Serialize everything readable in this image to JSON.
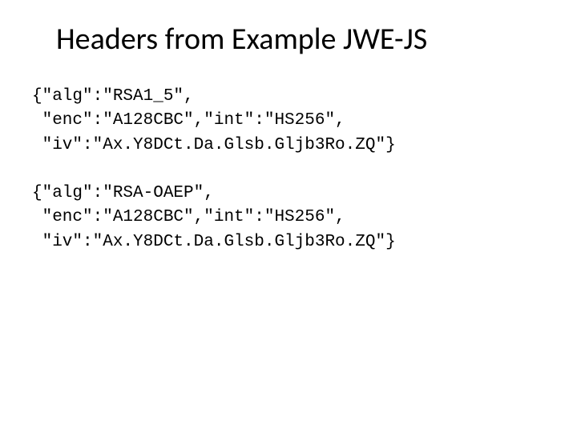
{
  "title": "Headers from Example JWE-JS",
  "code1": {
    "line1": "{\"alg\":\"RSA1_5\",",
    "line2": " \"enc\":\"A128CBC\",\"int\":\"HS256\",",
    "line3": " \"iv\":\"Ax.Y8DCt.Da.Glsb.Gljb3Ro.ZQ\"}"
  },
  "code2": {
    "line1": "{\"alg\":\"RSA-OAEP\",",
    "line2": " \"enc\":\"A128CBC\",\"int\":\"HS256\",",
    "line3": " \"iv\":\"Ax.Y8DCt.Da.Glsb.Gljb3Ro.ZQ\"}"
  }
}
